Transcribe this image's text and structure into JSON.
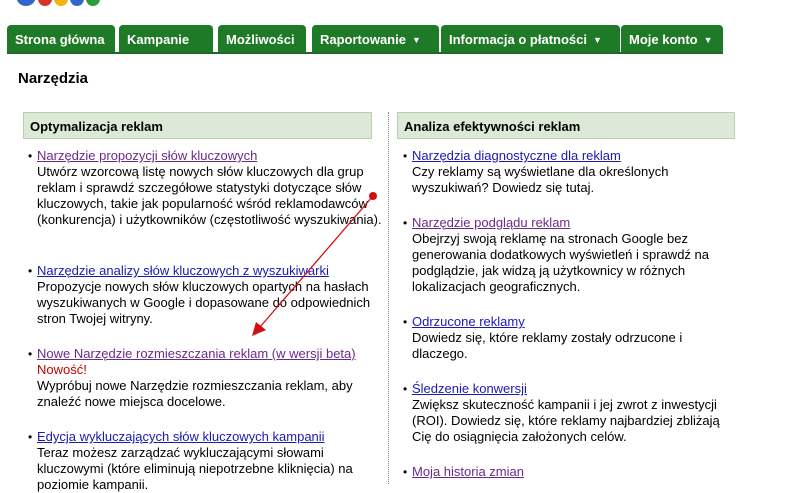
{
  "nav": {
    "tabs": [
      {
        "label": "Strona główna",
        "has_menu": false
      },
      {
        "label": "Kampanie",
        "has_menu": false
      },
      {
        "label": "Możliwości",
        "has_menu": false
      },
      {
        "label": "Raportowanie",
        "has_menu": true
      },
      {
        "label": "Informacja o płatności",
        "has_menu": true
      },
      {
        "label": "Moje konto",
        "has_menu": true
      }
    ]
  },
  "page": {
    "title": "Narzędzia"
  },
  "left": {
    "header": "Optymalizacja reklam",
    "items": [
      {
        "link": "Narzędzie propozycji słów kluczowych",
        "desc": "Utwórz wzorcową listę nowych słów kluczowych dla grup reklam i sprawdź szczegółowe statystyki dotyczące słów kluczowych, takie jak popularność wśród reklamodawców (konkurencja) i użytkowników (częstotliwość wyszukiwania)."
      },
      {
        "link": "Narzędzie analizy słów kluczowych z wyszukiwarki",
        "desc": "Propozycje nowych słów kluczowych opartych na hasłach wyszukiwanych w Google i dopasowane do odpowiednich stron Twojej witryny."
      },
      {
        "link": "Nowe Narzędzie rozmieszczania reklam (w wersji beta)",
        "new": "Nowość!",
        "desc": "Wypróbuj nowe Narzędzie rozmieszczania reklam, aby znaleźć nowe miejsca docelowe."
      },
      {
        "link": "Edycja wykluczających słów kluczowych kampanii",
        "desc": "Teraz możesz zarządzać wykluczającymi słowami kluczowymi (które eliminują niepotrzebne kliknięcia) na poziomie kampanii."
      }
    ]
  },
  "right": {
    "header": "Analiza efektywności reklam",
    "items": [
      {
        "link": "Narzędzia diagnostyczne dla reklam",
        "desc": "Czy reklamy są wyświetlane dla określonych wyszukiwań? Dowiedz się tutaj."
      },
      {
        "link": "Narzędzie podglądu reklam",
        "desc": "Obejrzyj swoją reklamę na stronach Google bez generowania dodatkowych wyświetleń i sprawdź na podglądzie, jak widzą ją użytkownicy w różnych lokalizacjach geograficznych."
      },
      {
        "link": "Odrzucone reklamy",
        "desc": "Dowiedz się, które reklamy zostały odrzucone i dlaczego."
      },
      {
        "link": "Śledzenie konwersji",
        "desc": "Zwiększ skuteczność kampanii i jej zwrot z inwestycji (ROI). Dowiedz się, które reklamy najbardziej zbliżają Cię do osiągnięcia założonych celów."
      },
      {
        "link": "Moja historia zmian",
        "desc": ""
      }
    ]
  },
  "colors": {
    "nav_green": "#1f7a27",
    "header_bg": "#dbe9d6",
    "link": "#1a1ab0",
    "visited": "#6b2a8a",
    "new": "#c00000",
    "annotation_arrow": "#d01010"
  }
}
